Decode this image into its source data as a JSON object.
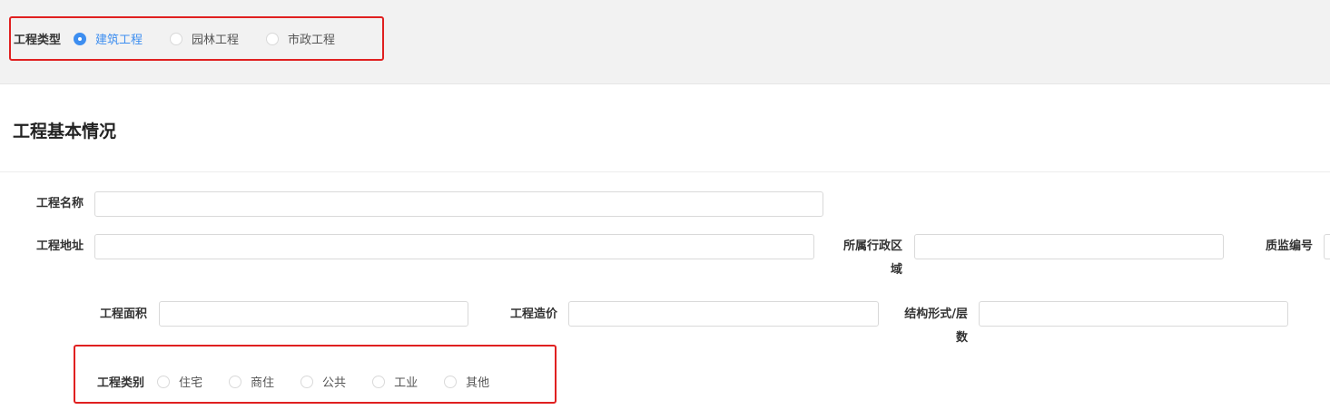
{
  "project_type": {
    "label": "工程类型",
    "options": [
      {
        "label": "建筑工程",
        "checked": true
      },
      {
        "label": "园林工程",
        "checked": false
      },
      {
        "label": "市政工程",
        "checked": false
      }
    ]
  },
  "section": {
    "title": "工程基本情况"
  },
  "form": {
    "name_label": "工程名称",
    "name_value": "",
    "address_label": "工程地址",
    "address_value": "",
    "region_label": "所属行政区域",
    "region_value": "",
    "qc_label": "质监编号",
    "qc_value": "",
    "area_label": "工程面积",
    "area_value": "",
    "cost_label": "工程造价",
    "cost_value": "",
    "structure_label": "结构形式/层数",
    "structure_value": ""
  },
  "project_category": {
    "label": "工程类别",
    "options": [
      {
        "label": "住宅",
        "checked": false
      },
      {
        "label": "商住",
        "checked": false
      },
      {
        "label": "公共",
        "checked": false
      },
      {
        "label": "工业",
        "checked": false
      },
      {
        "label": "其他",
        "checked": false
      }
    ]
  },
  "colors": {
    "accent": "#3d8ef0",
    "highlight": "#e02020"
  }
}
